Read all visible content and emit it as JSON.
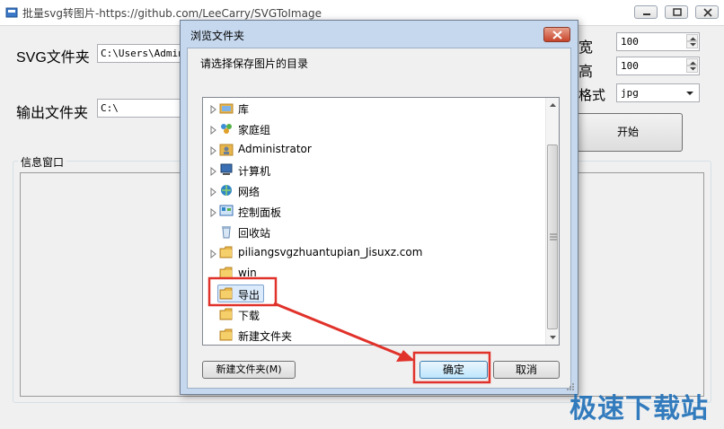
{
  "main_window": {
    "title": "批量svg转图片-https://github.com/LeeCarry/SVGToImage",
    "svg_folder_label": "SVG文件夹",
    "svg_folder_value": "C:\\Users\\Admini",
    "output_folder_label": "输出文件夹",
    "output_folder_value": "C:\\",
    "width_label": "宽",
    "width_value": "100",
    "height_label": "高",
    "height_value": "100",
    "format_label": "格式",
    "format_value": "jpg",
    "start_button": "开始",
    "info_group_label": "信息窗口"
  },
  "dialog": {
    "title": "浏览文件夹",
    "prompt": "请选择保存图片的目录",
    "tree_items": [
      {
        "label": "库",
        "icon": "library-icon",
        "expandable": true
      },
      {
        "label": "家庭组",
        "icon": "homegroup-icon",
        "expandable": true
      },
      {
        "label": "Administrator",
        "icon": "user-folder-icon",
        "expandable": true
      },
      {
        "label": "计算机",
        "icon": "computer-icon",
        "expandable": true
      },
      {
        "label": "网络",
        "icon": "network-icon",
        "expandable": true
      },
      {
        "label": "控制面板",
        "icon": "control-panel-icon",
        "expandable": true
      },
      {
        "label": "回收站",
        "icon": "recycle-bin-icon",
        "expandable": false
      },
      {
        "label": "piliangsvgzhuantupian_Jisuxz.com",
        "icon": "folder-icon",
        "expandable": true
      },
      {
        "label": "win",
        "icon": "folder-icon",
        "expandable": false
      },
      {
        "label": "导出",
        "icon": "folder-icon",
        "expandable": false,
        "selected": true
      },
      {
        "label": "下载",
        "icon": "folder-icon",
        "expandable": false
      },
      {
        "label": "新建文件夹",
        "icon": "folder-icon",
        "expandable": false
      }
    ],
    "new_folder_button": "新建文件夹(M)",
    "ok_button": "确定",
    "cancel_button": "取消"
  },
  "watermark": "极速下载站",
  "colors": {
    "highlight_red": "#e0322a",
    "folder_yellow": "#e8b64a",
    "watermark_blue": "#1e6fb8"
  }
}
